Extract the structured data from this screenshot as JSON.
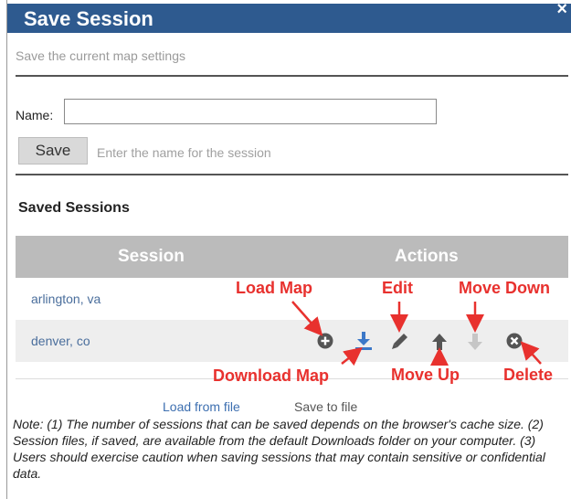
{
  "dialog": {
    "title": "Save Session",
    "close_glyph": "×",
    "subtitle": "Save the current map settings"
  },
  "form": {
    "name_label": "Name:",
    "name_value": "",
    "save_label": "Save",
    "save_hint": "Enter the name for the session"
  },
  "sessions": {
    "section_title": "Saved Sessions",
    "columns": [
      "Session",
      "Actions"
    ],
    "rows": [
      {
        "name": "arlington, va"
      },
      {
        "name": "denver, co",
        "actions": [
          "load-map",
          "download-map",
          "edit",
          "move-up",
          "move-down",
          "delete"
        ]
      }
    ]
  },
  "annotations": {
    "load_map": "Load Map",
    "edit": "Edit",
    "move_down": "Move Down",
    "download_map": "Download Map",
    "move_up": "Move Up",
    "delete": "Delete"
  },
  "links": {
    "load_from_file": "Load from file",
    "save_to_file": "Save to file"
  },
  "note": "Note: (1) The number of sessions that can be saved depends on the browser's cache size. (2) Session files, if saved, are available from the default Downloads folder on your computer. (3) Users should exercise caution when saving sessions that may contain sensitive or confidential data.",
  "colors": {
    "title_bar": "#2e5a8f",
    "header": "#bbbbbb",
    "annotation": "#e8312e",
    "link": "#3d6fb0"
  },
  "icons": [
    "close-icon",
    "plus-circle-icon",
    "download-icon",
    "pencil-icon",
    "arrow-up-icon",
    "arrow-down-icon",
    "x-circle-icon"
  ]
}
